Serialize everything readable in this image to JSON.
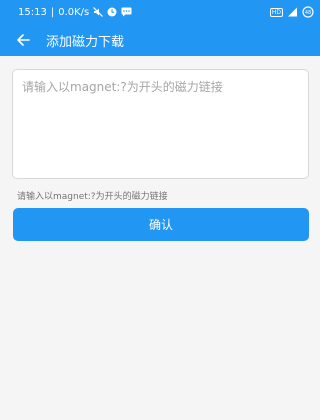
{
  "status_bar": {
    "time": "15:13",
    "separator": "|",
    "net_speed": "0.0K/s",
    "volte_badge": "HD",
    "battery": "48",
    "icons": [
      "mute-icon",
      "clock-icon",
      "message-icon",
      "hd-badge-icon",
      "signal-icon",
      "battery-icon"
    ]
  },
  "app_bar": {
    "title": "添加磁力下载",
    "back_icon": "arrow-left-icon"
  },
  "form": {
    "input_placeholder": "请输入以magnet:?为开头的磁力链接",
    "input_value": "",
    "hint": "请输入以magnet:?为开头的磁力链接",
    "confirm_label": "确认"
  },
  "colors": {
    "primary": "#2196f3",
    "background": "#f5f5f5",
    "input_background": "#ffffff",
    "input_border": "#d8d8d8",
    "hint_text": "#757575",
    "placeholder_text": "#a6a6a6"
  }
}
